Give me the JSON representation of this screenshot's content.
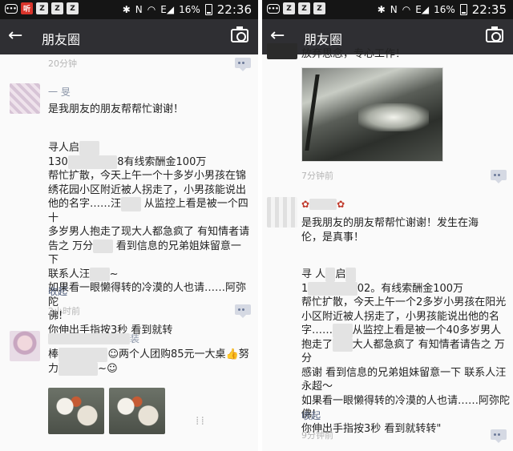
{
  "status": {
    "icons": [
      "msg-icon",
      "app-icon-red",
      "z-icon",
      "z-icon",
      "z-icon"
    ],
    "network": "N",
    "signal_letter": "E",
    "battery": "16%",
    "time_left": "22:36",
    "time_right": "22:35"
  },
  "appbar": {
    "title": "朋友圈"
  },
  "left": {
    "post0_time": "20分钟",
    "post1": {
      "nick": "一 旻",
      "line1": "是我朋友的朋友帮帮忙谢谢！",
      "body": [
        "寻人启",
        "130",
        "8有线索酬金100万",
        "帮忙扩散，今天上午一个十多岁小男孩在锦",
        "绣花园小区附近被人拐走了，小男孩能说出",
        "他的名字……汪",
        "从监控上看是被一个四十",
        "多岁男人抱走了现大人都急疯了 有知情者请",
        "告之 万分",
        "看到信息的兄弟姐妹留意一下",
        "联系人汪",
        "如果看一眼懒得转的冷漠的人也请……阿弥陀",
        "佛!",
        "你伸出手指按3秒 看到就转"
      ],
      "collapse": "收起",
      "time": "2小时前"
    },
    "post2": {
      "nick": "装",
      "line1a": "棒",
      "line1b": "两个人团购85元一大桌",
      "line1c": "努",
      "line2a": "力",
      "line2b": "~"
    }
  },
  "right": {
    "post0": {
      "line": "放弃思念，专心工作！",
      "time": "7分钟前"
    },
    "post1": {
      "line1": "是我朋友的朋友帮帮忙谢谢！发生在海",
      "line2": "伦，是真事！",
      "body": [
        "寻",
        "人",
        "启",
        "1",
        "02。有线索酬金100万",
        "帮忙扩散，今天上午一个2多岁小男孩在阳光",
        "小区附近被人拐走了，小男孩能说出他的名",
        "字……",
        "从监控上看是被一个40多岁男人",
        "抱走了",
        "大人都急疯了 有知情者请告之 万分",
        "感谢 看到信息的兄弟姐妹留意一下 联系人汪",
        "永超～",
        "如果看一眼懒得转的冷漠的人也请……阿弥陀",
        "佛!",
        "你伸出手指按3秒 看到就转转\""
      ],
      "collapse": "收起",
      "time": "9分钟前"
    }
  }
}
